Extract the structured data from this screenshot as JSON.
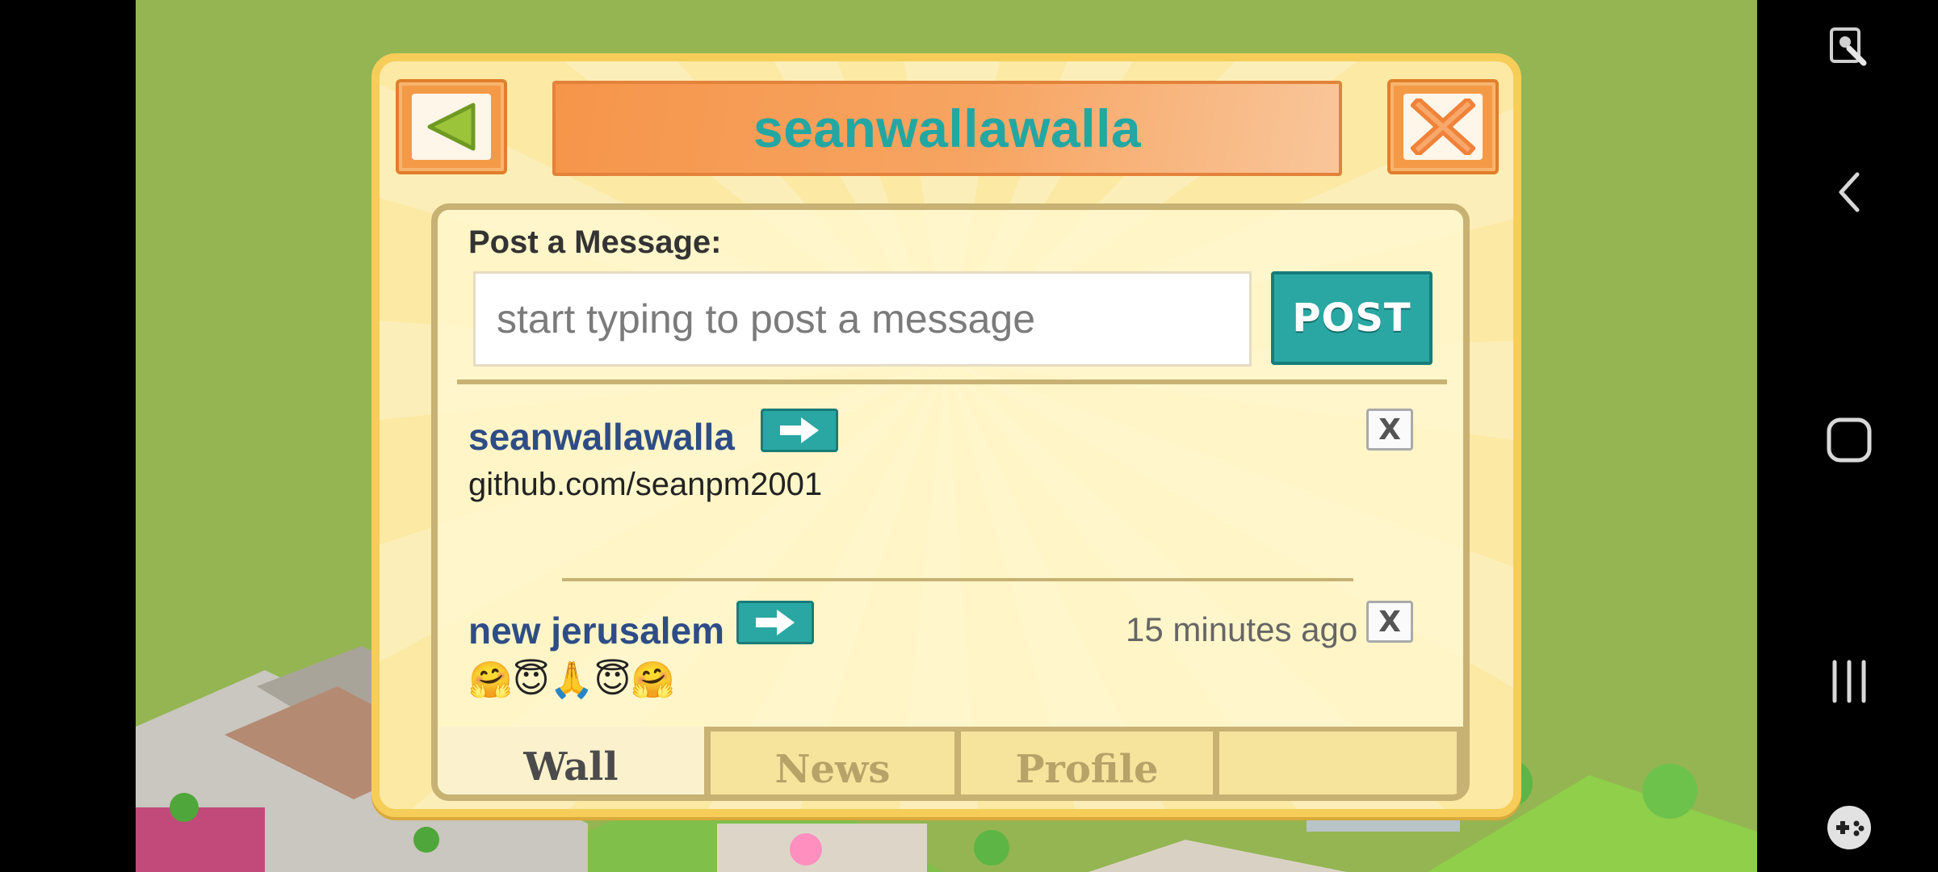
{
  "dialog": {
    "title": "seanwallawalla",
    "post_label": "Post a Message:",
    "input_placeholder": "start typing to post a message",
    "post_button": "POST",
    "close_glyph": "X"
  },
  "wall_posts": [
    {
      "author": "seanwallawalla",
      "body": "github.com/seanpm2001",
      "time": "",
      "delete_glyph": "X"
    },
    {
      "author": "new jerusalem",
      "body": "🤗😇🙏😇🤗",
      "time": "15 minutes ago",
      "delete_glyph": "X"
    }
  ],
  "tabs": [
    {
      "label": "Wall",
      "active": true
    },
    {
      "label": "News",
      "active": false
    },
    {
      "label": "Profile",
      "active": false
    },
    {
      "label": "",
      "active": false
    }
  ],
  "nav_icons": [
    "screen-lock-icon",
    "back-icon",
    "home-icon",
    "recents-icon",
    "game-tools-icon"
  ],
  "colors": {
    "background_grass": "#94b552",
    "dialog_fill": "#fbe9a4",
    "title_text": "#22a7a3",
    "teal_button": "#2aa7a3",
    "author_text": "#2e4d86",
    "header_orange": "#f6954a"
  }
}
